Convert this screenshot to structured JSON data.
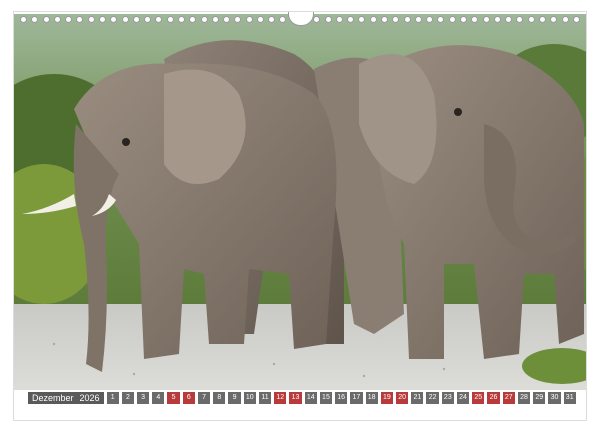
{
  "calendar": {
    "month": "Dezember",
    "year": "2026",
    "days": [
      {
        "label": "1",
        "weekend": false
      },
      {
        "label": "2",
        "weekend": false
      },
      {
        "label": "3",
        "weekend": false
      },
      {
        "label": "4",
        "weekend": false
      },
      {
        "label": "5",
        "weekend": true
      },
      {
        "label": "6",
        "weekend": true
      },
      {
        "label": "7",
        "weekend": false
      },
      {
        "label": "8",
        "weekend": false
      },
      {
        "label": "9",
        "weekend": false
      },
      {
        "label": "10",
        "weekend": false
      },
      {
        "label": "11",
        "weekend": false
      },
      {
        "label": "12",
        "weekend": true
      },
      {
        "label": "13",
        "weekend": true
      },
      {
        "label": "14",
        "weekend": false
      },
      {
        "label": "15",
        "weekend": false
      },
      {
        "label": "16",
        "weekend": false
      },
      {
        "label": "17",
        "weekend": false
      },
      {
        "label": "18",
        "weekend": false
      },
      {
        "label": "19",
        "weekend": true
      },
      {
        "label": "20",
        "weekend": true
      },
      {
        "label": "21",
        "weekend": false
      },
      {
        "label": "22",
        "weekend": false
      },
      {
        "label": "23",
        "weekend": false
      },
      {
        "label": "24",
        "weekend": false
      },
      {
        "label": "25",
        "weekend": true
      },
      {
        "label": "26",
        "weekend": true
      },
      {
        "label": "27",
        "weekend": true
      },
      {
        "label": "28",
        "weekend": false
      },
      {
        "label": "29",
        "weekend": false
      },
      {
        "label": "30",
        "weekend": false
      },
      {
        "label": "31",
        "weekend": false
      }
    ]
  },
  "colors": {
    "weekday": "#6a6a6a",
    "weekend": "#b83a3a",
    "month_bg": "#5a5a5a"
  }
}
